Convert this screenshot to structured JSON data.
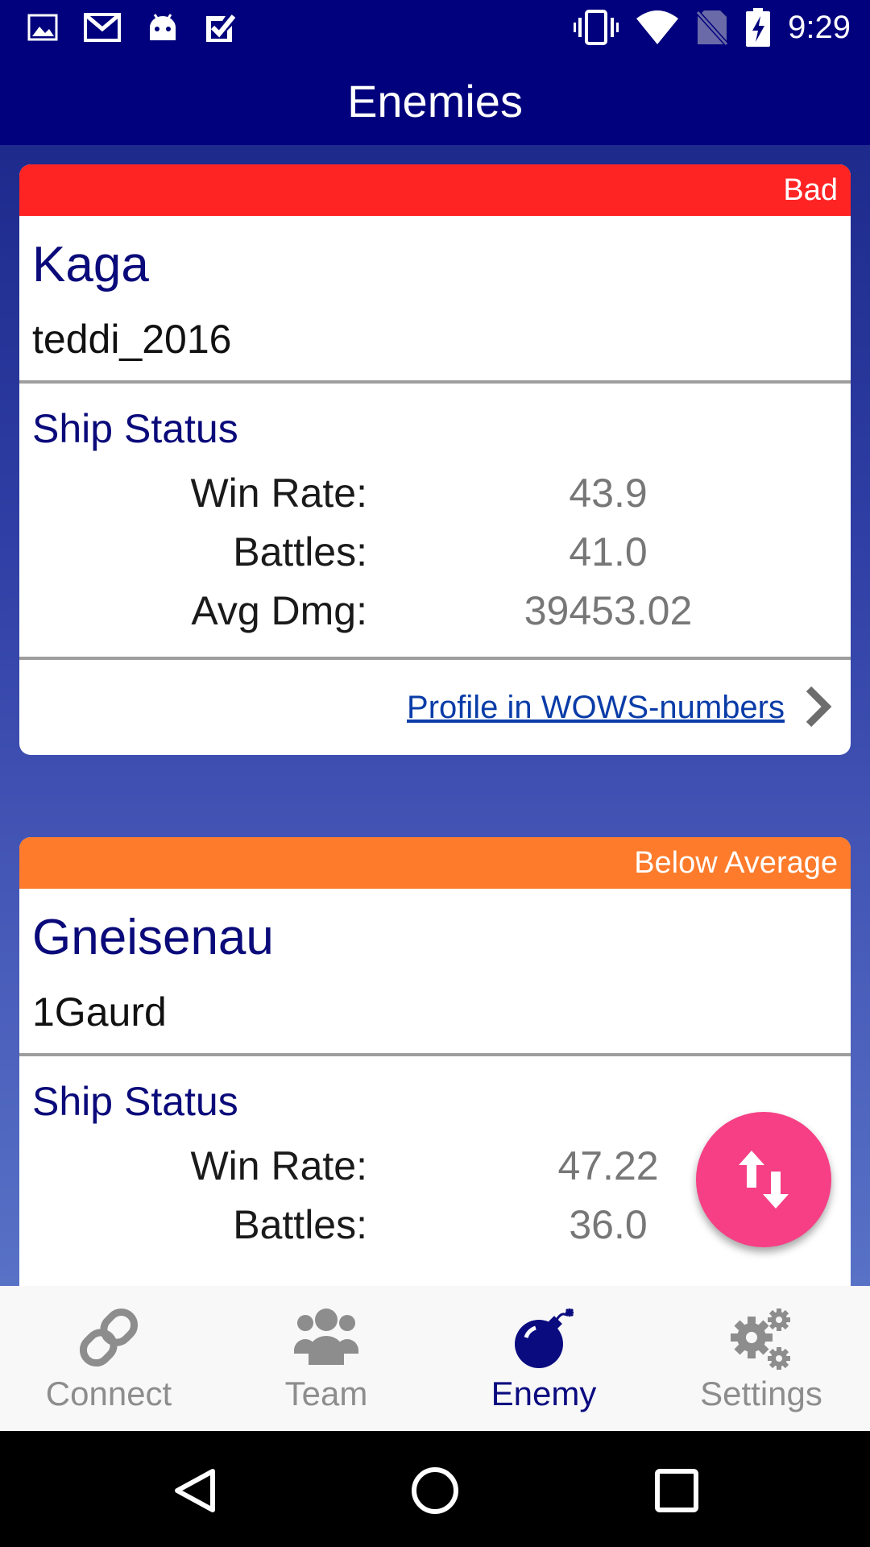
{
  "status_bar": {
    "time": "9:29",
    "left_icons": [
      "image-icon",
      "mail-icon",
      "android-icon",
      "check-icon"
    ],
    "right_icons": [
      "vibrate-icon",
      "wifi-icon",
      "no-sim-icon",
      "battery-charging-icon"
    ]
  },
  "app_bar": {
    "title": "Enemies"
  },
  "cards": [
    {
      "rating": "Bad",
      "rating_color": "#ff2424",
      "ship": "Kaga",
      "player": "teddi_2016",
      "section_title": "Ship Status",
      "stats": [
        {
          "label": "Win Rate:",
          "value": "43.9"
        },
        {
          "label": "Battles:",
          "value": "41.0"
        },
        {
          "label": "Avg Dmg:",
          "value": "39453.02"
        }
      ],
      "link": "Profile in WOWS-numbers"
    },
    {
      "rating": "Below Average",
      "rating_color": "#fd7b2b",
      "ship": "Gneisenau",
      "player": "1Gaurd",
      "section_title": "Ship Status",
      "stats": [
        {
          "label": "Win Rate:",
          "value": "47.22"
        },
        {
          "label": "Battles:",
          "value": "36.0"
        }
      ]
    }
  ],
  "fab": {
    "icon": "swap-vertical-icon",
    "color": "#f63f85"
  },
  "bottom_nav": {
    "items": [
      {
        "label": "Connect",
        "icon": "link-icon"
      },
      {
        "label": "Team",
        "icon": "team-icon"
      },
      {
        "label": "Enemy",
        "icon": "bomb-icon",
        "active": true
      },
      {
        "label": "Settings",
        "icon": "gear-icon"
      }
    ],
    "active_color": "#0b0b80",
    "inactive_color": "#8d8d8d"
  },
  "system_nav": [
    "back-icon",
    "home-icon",
    "recents-icon"
  ]
}
